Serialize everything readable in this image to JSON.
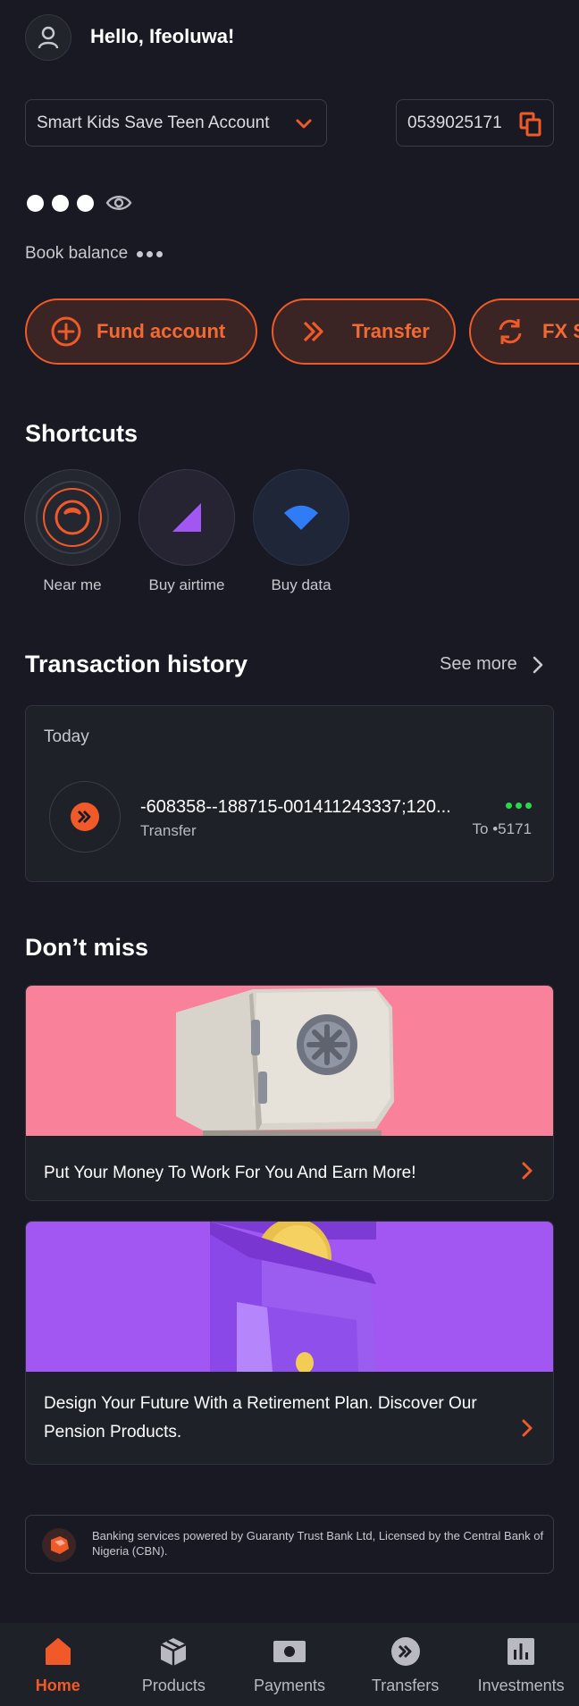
{
  "header": {
    "greeting": "Hello, Ifeoluwa!"
  },
  "account": {
    "name": "Smart Kids Save Teen Account",
    "number": "0539025171"
  },
  "balance": {
    "label": "Book balance"
  },
  "actions": [
    {
      "label": "Fund account",
      "icon": "plus-circle-icon"
    },
    {
      "label": "Transfer",
      "icon": "double-chevron-icon"
    },
    {
      "label": "FX S",
      "icon": "exchange-icon"
    }
  ],
  "shortcuts": {
    "title": "Shortcuts",
    "items": [
      {
        "label": "Near me",
        "icon": "near-me-icon"
      },
      {
        "label": "Buy airtime",
        "icon": "signal-triangle-icon"
      },
      {
        "label": "Buy data",
        "icon": "wifi-icon"
      }
    ]
  },
  "transactions": {
    "title": "Transaction history",
    "see_more": "See more",
    "group_label": "Today",
    "items": [
      {
        "reference": "-608358--188715-001411243337;120...",
        "type": "Transfer",
        "to": "To •5171"
      }
    ]
  },
  "dont_miss": {
    "title": "Don’t miss",
    "promos": [
      {
        "text": "Put Your Money To Work For You And Earn More!"
      },
      {
        "text": "Design Your Future With a Retirement Plan. Discover Our Pension Products."
      }
    ]
  },
  "footer": {
    "disclaimer": "Banking services powered by Guaranty Trust Bank Ltd, Licensed by the Central Bank of Nigeria (CBN)."
  },
  "nav": [
    {
      "label": "Home",
      "active": true
    },
    {
      "label": "Products"
    },
    {
      "label": "Payments"
    },
    {
      "label": "Transfers"
    },
    {
      "label": "Investments"
    }
  ],
  "colors": {
    "background": "#181922",
    "accent": "#f05a28",
    "card": "#1f2129",
    "status_green": "#2bd64d",
    "promo_pink": "#f98199",
    "promo_purple": "#a257f3"
  }
}
